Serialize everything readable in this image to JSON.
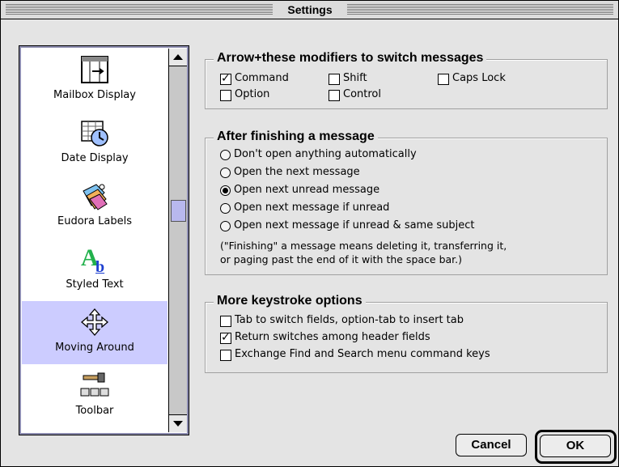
{
  "window": {
    "title": "Settings"
  },
  "sidebar": {
    "items": [
      {
        "label": "Mailbox Display",
        "icon": "mailbox-display-icon"
      },
      {
        "label": "Date Display",
        "icon": "date-display-icon"
      },
      {
        "label": "Eudora Labels",
        "icon": "eudora-labels-icon"
      },
      {
        "label": "Styled Text",
        "icon": "styled-text-icon"
      },
      {
        "label": "Moving Around",
        "icon": "moving-around-icon",
        "selected": true
      },
      {
        "label": "Toolbar",
        "icon": "toolbar-icon"
      }
    ]
  },
  "modifiers": {
    "title": "Arrow+these modifiers to switch messages",
    "options": [
      {
        "label": "Command",
        "checked": true
      },
      {
        "label": "Shift",
        "checked": false
      },
      {
        "label": "Caps Lock",
        "checked": false
      },
      {
        "label": "Option",
        "checked": false
      },
      {
        "label": "Control",
        "checked": false
      }
    ]
  },
  "after_finishing": {
    "title": "After finishing a message",
    "options": [
      {
        "label": "Don't open anything automatically",
        "selected": false
      },
      {
        "label": "Open the next message",
        "selected": false
      },
      {
        "label": "Open next unread message",
        "selected": true
      },
      {
        "label": "Open next message if unread",
        "selected": false
      },
      {
        "label": "Open next message if unread & same subject",
        "selected": false
      }
    ],
    "note_line1": "(\"Finishing\" a message means deleting it, transferring it,",
    "note_line2": "or paging past the end of it with the space bar.)"
  },
  "keystroke": {
    "title": "More keystroke options",
    "options": [
      {
        "label": "Tab to switch fields, option-tab to insert tab",
        "checked": false
      },
      {
        "label": "Return switches among header fields",
        "checked": true
      },
      {
        "label": "Exchange Find and Search menu command keys",
        "checked": false
      }
    ]
  },
  "buttons": {
    "cancel": "Cancel",
    "ok": "OK"
  },
  "colors": {
    "selection": "#ccccff",
    "window_bg": "#e4e4e4"
  }
}
